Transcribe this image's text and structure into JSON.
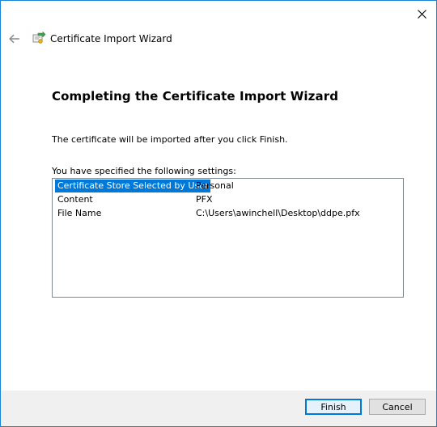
{
  "window": {
    "title": "Certificate Import Wizard",
    "close_icon": "close-icon",
    "back_icon": "back-arrow-icon",
    "app_icon": "certificate-icon",
    "accent_color": "#0078d7"
  },
  "main": {
    "heading": "Completing the Certificate Import Wizard",
    "info": "The certificate will be imported after you click Finish.",
    "settings_label": "You have specified the following settings:",
    "settings": [
      {
        "key": "Certificate Store Selected by User",
        "value": "Personal",
        "selected": true
      },
      {
        "key": "Content",
        "value": "PFX",
        "selected": false
      },
      {
        "key": "File Name",
        "value": "C:\\Users\\awinchell\\Desktop\\ddpe.pfx",
        "selected": false
      }
    ]
  },
  "footer": {
    "finish_label": "Finish",
    "cancel_label": "Cancel"
  }
}
